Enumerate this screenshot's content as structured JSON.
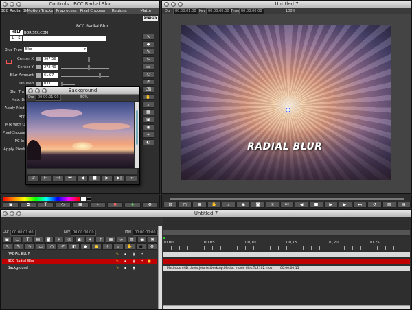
{
  "controls": {
    "title": "Controls : BCC Radial Blur",
    "tabs": [
      "BCC Radial Blur",
      "Motion Tracker",
      "Preprocess",
      "Pixel Chooser",
      "Regions",
      "Matte"
    ],
    "plugin_name": "BCC Radial Blur",
    "help_label": "HELP",
    "brand": "BORISFX.COM",
    "brand_logo": "BORISFX",
    "preset_keys": [
      "L",
      "S"
    ],
    "blur_type_label": "Blur Type",
    "blur_type_value": "Blur",
    "params": [
      {
        "label": "Center X",
        "value": "367.56"
      },
      {
        "label": "Center Y",
        "value": "272.40"
      },
      {
        "label": "Blur Amount",
        "value": "61.97"
      },
      {
        "label": "Unused",
        "value": "0.00"
      }
    ],
    "extra_labels": [
      "Blur Thre",
      "Max. Bri",
      "Apply Mode",
      "Appl",
      "Mix with Or",
      "PixelChooser",
      "PC Inh",
      "Apply PixelC"
    ],
    "tool_icons": [
      "cursor-icon",
      "keyframe-icon",
      "pen-icon",
      "bezier-icon",
      "rectangle-icon",
      "oval-icon",
      "brush-icon",
      "eraser-icon",
      "hand-icon",
      "zoom-icon"
    ]
  },
  "background": {
    "title": "Background",
    "dur_label": "Dur",
    "dur_value": "00:00:01:00",
    "scale": "50%"
  },
  "viewer": {
    "title": "Untitled 7",
    "dur_label": "Dur",
    "dur_value": "00:00:01:00",
    "key_label": "Key",
    "key_value": "00:00:00:00",
    "time_label": "Time",
    "time_value": "00:00:00:00",
    "zoom": "100%",
    "overlay_text": "RADIAL BLUR"
  },
  "palette": {
    "colors": [
      "#ff0000",
      "#ff8800",
      "#ffff00",
      "#00ff00",
      "#00ffff",
      "#0000ff",
      "#ff00ff",
      "#ffffff",
      "#000000"
    ]
  },
  "timeline": {
    "title": "Untitled 7",
    "dur_label": "Dur",
    "dur_value": "00:00:01:00",
    "key_label": "Key",
    "key_value": "00:00:00:00",
    "time_label": "Time",
    "time_value": "00:00:00:00",
    "ruler": [
      "00,00",
      "00,05",
      "00,10",
      "00,15",
      "00,20",
      "00,25"
    ],
    "tracks": [
      {
        "name": "RADIAL BLUR",
        "selected": false
      },
      {
        "name": "BCC Radial Blur",
        "selected": true
      },
      {
        "name": "Background",
        "selected": false
      }
    ],
    "clip_path": "Macintosh HD:Users:jeforte:Desktop:Media: movie files:TL2102.mov",
    "clip_time": "00:00:00:15"
  }
}
